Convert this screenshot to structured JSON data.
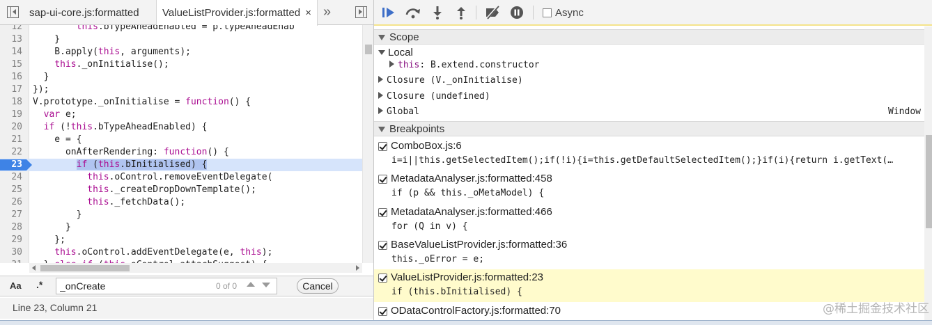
{
  "tabs": {
    "tab1": "sap-ui-core.js:formatted",
    "tab2": "ValueListProvider.js:formatted",
    "close_glyph": "×",
    "more_glyph": "»"
  },
  "code_lines": [
    {
      "n": "12",
      "html": "        <span class='kw'>this</span>.bTypeAheadEnabled = p.typeAheadEnab"
    },
    {
      "n": "13",
      "html": "    }"
    },
    {
      "n": "14",
      "html": "    B.apply(<span class='kw'>this</span>, arguments);"
    },
    {
      "n": "15",
      "html": "    <span class='kw'>this</span>._onInitialise();"
    },
    {
      "n": "16",
      "html": "  }"
    },
    {
      "n": "17",
      "html": "});"
    },
    {
      "n": "18",
      "html": "V.prototype._onInitialise = <span class='kw'>function</span>() {"
    },
    {
      "n": "19",
      "html": "  <span class='kw'>var</span> e;"
    },
    {
      "n": "20",
      "html": "  <span class='kw'>if</span> (!<span class='kw'>this</span>.bTypeAheadEnabled) {"
    },
    {
      "n": "21",
      "html": "    e = {"
    },
    {
      "n": "22",
      "html": "      onAfterRendering: <span class='kw'>function</span>() {"
    },
    {
      "n": "23",
      "html": "        <span class='sel'><span class='kw'>if</span> (<span class='kw'>this</span>.bInitialised) {</span>",
      "bp": true
    },
    {
      "n": "24",
      "html": "          <span class='kw'>this</span>.oControl.removeEventDelegate("
    },
    {
      "n": "25",
      "html": "          <span class='kw'>this</span>._createDropDownTemplate();"
    },
    {
      "n": "26",
      "html": "          <span class='kw'>this</span>._fetchData();"
    },
    {
      "n": "27",
      "html": "        }"
    },
    {
      "n": "28",
      "html": "      }"
    },
    {
      "n": "29",
      "html": "    };"
    },
    {
      "n": "30",
      "html": "    <span class='kw'>this</span>.oControl.addEventDelegate(e, <span class='kw'>this</span>);"
    },
    {
      "n": "31",
      "html": "  } <span class='kw'>else if</span> (<span class='kw'>this</span>.oControl.attachSuggest) {"
    }
  ],
  "search": {
    "case_label": "Aa",
    "regex_label": ".*",
    "value": "_onCreate",
    "match_count": "0 of 0",
    "cancel_label": "Cancel"
  },
  "status": "Line 23, Column 21",
  "debugger": {
    "async_label": "Async"
  },
  "scope": {
    "title": "Scope",
    "local_label": "Local",
    "this_key": "this",
    "this_value": ": B.extend.constructor",
    "closure1": "Closure (V._onInitialise)",
    "closure2": "Closure (undefined)",
    "global_label": "Global",
    "global_value": "Window"
  },
  "breakpoints": {
    "title": "Breakpoints",
    "items": [
      {
        "file": "ComboBox.js:6",
        "code": "i=i||this.getSelectedItem();if(!i){i=this.getDefaultSelectedItem();}if(i){return i.getText(…",
        "active": false
      },
      {
        "file": "MetadataAnalyser.js:formatted:458",
        "code": "if (p && this._oMetaModel) {",
        "active": false
      },
      {
        "file": "MetadataAnalyser.js:formatted:466",
        "code": "for (Q in v) {",
        "active": false
      },
      {
        "file": "BaseValueListProvider.js:formatted:36",
        "code": "this._oError = e;",
        "active": false
      },
      {
        "file": "ValueListProvider.js:formatted:23",
        "code": "if (this.bInitialised) {",
        "active": true
      },
      {
        "file": "ODataControlFactory.js:formatted:70",
        "code": "",
        "active": false
      }
    ]
  },
  "watermark": "@稀土掘金技术社区",
  "colors": {
    "breakpoint_blue": "#3e83e6",
    "keyword": "#aa0d91",
    "active_breakpoint_bg": "#fffbcc",
    "toolbar_accent": "#f4e38a"
  },
  "icons": [
    "navigator-toggle-icon",
    "debugger-toggle-icon",
    "resume-icon",
    "step-over-icon",
    "step-into-icon",
    "step-out-icon",
    "deactivate-breakpoints-icon",
    "pause-on-exceptions-icon"
  ]
}
